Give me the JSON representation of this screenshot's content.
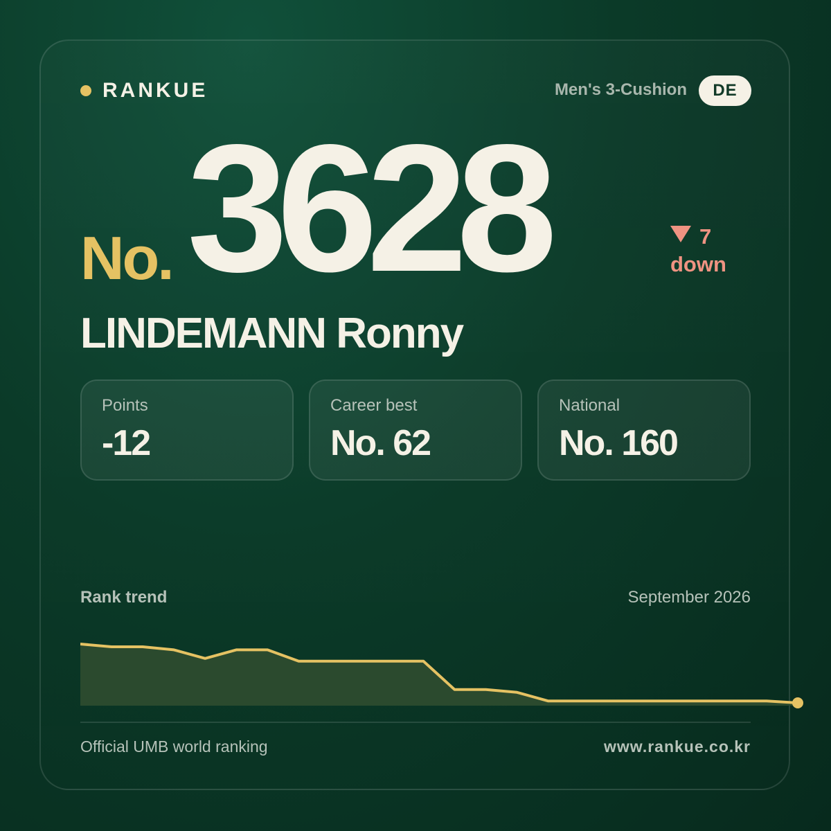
{
  "brand": {
    "name": "RANKUE",
    "dot_color": "#e5c263"
  },
  "category": "Men's 3-Cushion",
  "country_code": "DE",
  "rank": {
    "prefix": "No.",
    "number": "3628"
  },
  "change": {
    "direction": "down",
    "icon": "triangle-down-icon",
    "amount": "7",
    "label": "down",
    "color": "#ef9382"
  },
  "player_name": "LINDEMANN Ronny",
  "stats": [
    {
      "label": "Points",
      "value": "-12"
    },
    {
      "label": "Career best",
      "value": "No. 62"
    },
    {
      "label": "National",
      "value": "No. 160"
    }
  ],
  "trend": {
    "title": "Rank trend",
    "period": "September 2026",
    "line_color": "#e5c263"
  },
  "chart_data": {
    "type": "area",
    "x": [
      1,
      2,
      3,
      4,
      5,
      6,
      7,
      8,
      9,
      10,
      11,
      12,
      13,
      14,
      15,
      16,
      17,
      18,
      19,
      20,
      21,
      22,
      23,
      24
    ],
    "values": [
      3375,
      3387,
      3387,
      3400,
      3437,
      3400,
      3400,
      3449,
      3449,
      3449,
      3449,
      3449,
      3571,
      3571,
      3583,
      3620,
      3620,
      3620,
      3620,
      3620,
      3620,
      3620,
      3620,
      3628
    ],
    "ylim": [
      3262,
      3640
    ],
    "inverted_y": true,
    "highlight_last_point": true,
    "title": "",
    "xlabel": "",
    "ylabel": ""
  },
  "footer": {
    "source": "Official UMB world ranking",
    "url": "www.rankue.co.kr"
  },
  "colors": {
    "accent": "#e5c263",
    "background": "#0b3a28",
    "text": "#f5f1e6",
    "muted": "#b6c2b9",
    "negative": "#ef9382"
  }
}
